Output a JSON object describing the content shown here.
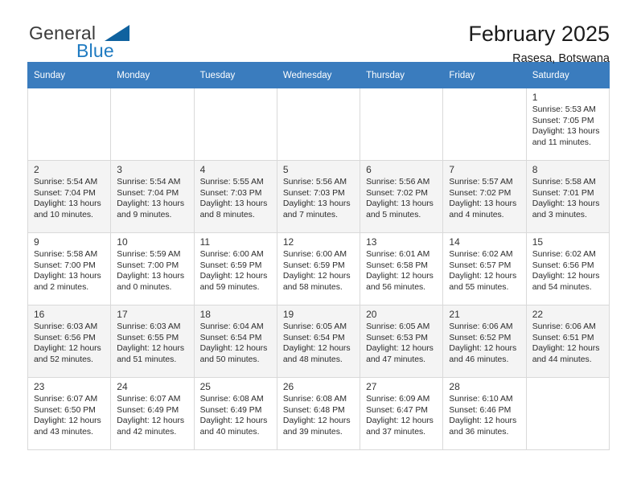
{
  "brand": {
    "name_part1": "General",
    "name_part2": "Blue",
    "logo_icon": "triangle-logo-icon",
    "accent_color": "#10629f",
    "blue_text_color": "#1f7bc1"
  },
  "header": {
    "month_title": "February 2025",
    "location": "Rasesa, Botswana"
  },
  "calendar": {
    "header_bg": "#3a7cbe",
    "weekdays": [
      "Sunday",
      "Monday",
      "Tuesday",
      "Wednesday",
      "Thursday",
      "Friday",
      "Saturday"
    ],
    "weeks": [
      [
        {
          "day": "",
          "info": "",
          "empty": true
        },
        {
          "day": "",
          "info": "",
          "empty": true
        },
        {
          "day": "",
          "info": "",
          "empty": true
        },
        {
          "day": "",
          "info": "",
          "empty": true
        },
        {
          "day": "",
          "info": "",
          "empty": true
        },
        {
          "day": "",
          "info": "",
          "empty": true
        },
        {
          "day": "1",
          "info": "Sunrise: 5:53 AM\nSunset: 7:05 PM\nDaylight: 13 hours\nand 11 minutes."
        }
      ],
      [
        {
          "day": "2",
          "info": "Sunrise: 5:54 AM\nSunset: 7:04 PM\nDaylight: 13 hours\nand 10 minutes."
        },
        {
          "day": "3",
          "info": "Sunrise: 5:54 AM\nSunset: 7:04 PM\nDaylight: 13 hours\nand 9 minutes."
        },
        {
          "day": "4",
          "info": "Sunrise: 5:55 AM\nSunset: 7:03 PM\nDaylight: 13 hours\nand 8 minutes."
        },
        {
          "day": "5",
          "info": "Sunrise: 5:56 AM\nSunset: 7:03 PM\nDaylight: 13 hours\nand 7 minutes."
        },
        {
          "day": "6",
          "info": "Sunrise: 5:56 AM\nSunset: 7:02 PM\nDaylight: 13 hours\nand 5 minutes."
        },
        {
          "day": "7",
          "info": "Sunrise: 5:57 AM\nSunset: 7:02 PM\nDaylight: 13 hours\nand 4 minutes."
        },
        {
          "day": "8",
          "info": "Sunrise: 5:58 AM\nSunset: 7:01 PM\nDaylight: 13 hours\nand 3 minutes."
        }
      ],
      [
        {
          "day": "9",
          "info": "Sunrise: 5:58 AM\nSunset: 7:00 PM\nDaylight: 13 hours\nand 2 minutes."
        },
        {
          "day": "10",
          "info": "Sunrise: 5:59 AM\nSunset: 7:00 PM\nDaylight: 13 hours\nand 0 minutes."
        },
        {
          "day": "11",
          "info": "Sunrise: 6:00 AM\nSunset: 6:59 PM\nDaylight: 12 hours\nand 59 minutes."
        },
        {
          "day": "12",
          "info": "Sunrise: 6:00 AM\nSunset: 6:59 PM\nDaylight: 12 hours\nand 58 minutes."
        },
        {
          "day": "13",
          "info": "Sunrise: 6:01 AM\nSunset: 6:58 PM\nDaylight: 12 hours\nand 56 minutes."
        },
        {
          "day": "14",
          "info": "Sunrise: 6:02 AM\nSunset: 6:57 PM\nDaylight: 12 hours\nand 55 minutes."
        },
        {
          "day": "15",
          "info": "Sunrise: 6:02 AM\nSunset: 6:56 PM\nDaylight: 12 hours\nand 54 minutes."
        }
      ],
      [
        {
          "day": "16",
          "info": "Sunrise: 6:03 AM\nSunset: 6:56 PM\nDaylight: 12 hours\nand 52 minutes."
        },
        {
          "day": "17",
          "info": "Sunrise: 6:03 AM\nSunset: 6:55 PM\nDaylight: 12 hours\nand 51 minutes."
        },
        {
          "day": "18",
          "info": "Sunrise: 6:04 AM\nSunset: 6:54 PM\nDaylight: 12 hours\nand 50 minutes."
        },
        {
          "day": "19",
          "info": "Sunrise: 6:05 AM\nSunset: 6:54 PM\nDaylight: 12 hours\nand 48 minutes."
        },
        {
          "day": "20",
          "info": "Sunrise: 6:05 AM\nSunset: 6:53 PM\nDaylight: 12 hours\nand 47 minutes."
        },
        {
          "day": "21",
          "info": "Sunrise: 6:06 AM\nSunset: 6:52 PM\nDaylight: 12 hours\nand 46 minutes."
        },
        {
          "day": "22",
          "info": "Sunrise: 6:06 AM\nSunset: 6:51 PM\nDaylight: 12 hours\nand 44 minutes."
        }
      ],
      [
        {
          "day": "23",
          "info": "Sunrise: 6:07 AM\nSunset: 6:50 PM\nDaylight: 12 hours\nand 43 minutes."
        },
        {
          "day": "24",
          "info": "Sunrise: 6:07 AM\nSunset: 6:49 PM\nDaylight: 12 hours\nand 42 minutes."
        },
        {
          "day": "25",
          "info": "Sunrise: 6:08 AM\nSunset: 6:49 PM\nDaylight: 12 hours\nand 40 minutes."
        },
        {
          "day": "26",
          "info": "Sunrise: 6:08 AM\nSunset: 6:48 PM\nDaylight: 12 hours\nand 39 minutes."
        },
        {
          "day": "27",
          "info": "Sunrise: 6:09 AM\nSunset: 6:47 PM\nDaylight: 12 hours\nand 37 minutes."
        },
        {
          "day": "28",
          "info": "Sunrise: 6:10 AM\nSunset: 6:46 PM\nDaylight: 12 hours\nand 36 minutes."
        },
        {
          "day": "",
          "info": "",
          "empty": true
        }
      ]
    ]
  }
}
